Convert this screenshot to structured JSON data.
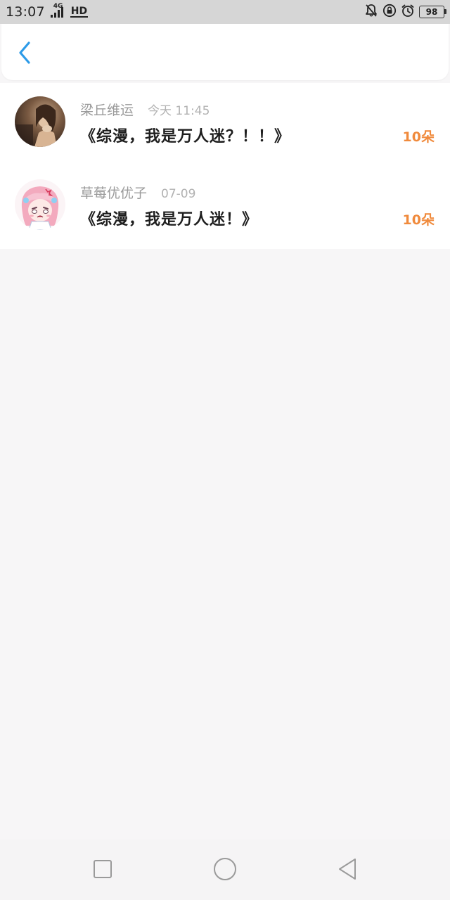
{
  "status_bar": {
    "time": "13:07",
    "network": "4G",
    "hd": "HD",
    "battery": "98",
    "icons": [
      "mute-bell-icon",
      "lock-rotation-icon",
      "alarm-icon"
    ]
  },
  "header": {
    "back_icon": "chevron-left-icon",
    "accent_color": "#2d9be8"
  },
  "list": {
    "items": [
      {
        "username": "梁丘维运",
        "timestamp": "今天 11:45",
        "title": "《综漫，我是万人迷？！！》",
        "flowers": "10朵"
      },
      {
        "username": "草莓优优子",
        "timestamp": "07-09",
        "title": "《综漫，我是万人迷！》",
        "flowers": "10朵"
      }
    ],
    "flower_color": "#f08a3c"
  },
  "nav_bar": {
    "buttons": [
      "recent-apps-icon",
      "home-icon",
      "back-triangle-icon"
    ]
  }
}
